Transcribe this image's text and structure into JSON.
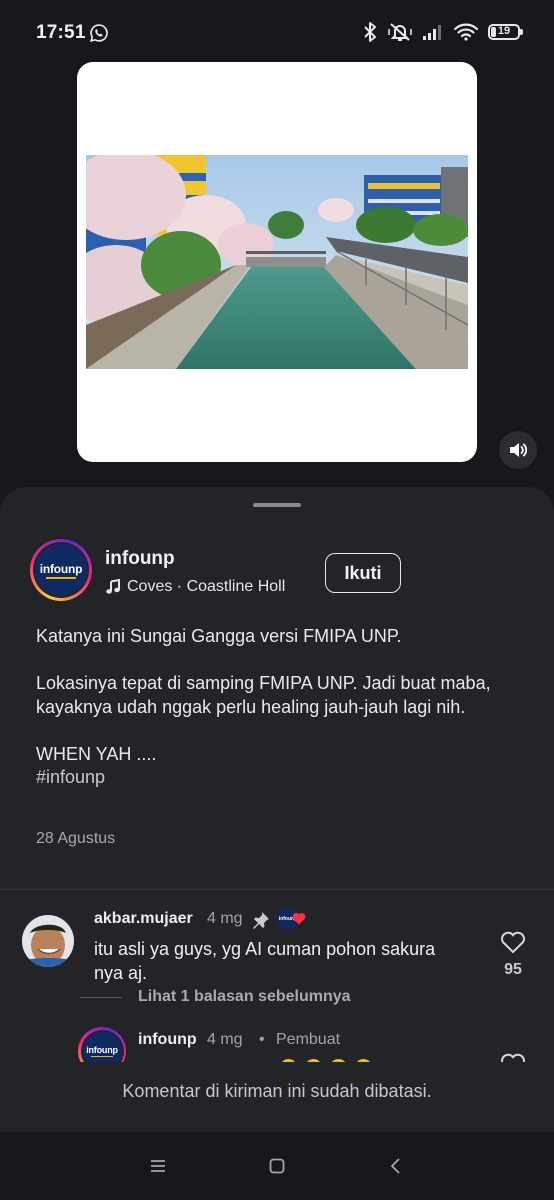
{
  "status_bar": {
    "time": "17:51",
    "battery_level": "19",
    "icons": [
      "whatsapp-icon",
      "bluetooth-icon",
      "silent-vibrate-icon",
      "cellular-signal-icon",
      "wifi-icon",
      "battery-icon"
    ]
  },
  "media": {
    "sound_icon": "speaker-volume-icon"
  },
  "post": {
    "username": "infounp",
    "avatar_text": "infounp",
    "music_icon": "music-note-icon",
    "music_text": "Coves · Coastline     Holl",
    "follow_label": "Ikuti",
    "caption": {
      "line1": "Katanya ini Sungai Gangga versi FMIPA UNP.",
      "line2": "Lokasinya tepat di samping FMIPA UNP. Jadi buat maba, kayaknya udah nggak perlu healing jauh-jauh lagi nih.",
      "line3": "WHEN YAH ....",
      "hashtag": "#infounp"
    },
    "date": "28 Agustus"
  },
  "comments": [
    {
      "username": "akbar.mujaer",
      "time": "4 mg",
      "text": "itu asli ya guys, yg AI cuman pohon sakura nya aj.",
      "likes": "95",
      "view_replies": "Lihat 1 balasan sebelumnya",
      "creator_badge_text": "infounp"
    }
  ],
  "reply": {
    "username": "infounp",
    "time": "4 mg",
    "dot": "•",
    "author_label": "Pembuat",
    "avatar_text": "infounp"
  },
  "footer": {
    "restricted_text": "Komentar di kiriman ini sudah dibatasi."
  },
  "colors": {
    "background": "#17181b",
    "sheet": "#232428",
    "text": "#e8e9ec",
    "muted": "#a3a4a9",
    "heart": "#ff3040"
  }
}
